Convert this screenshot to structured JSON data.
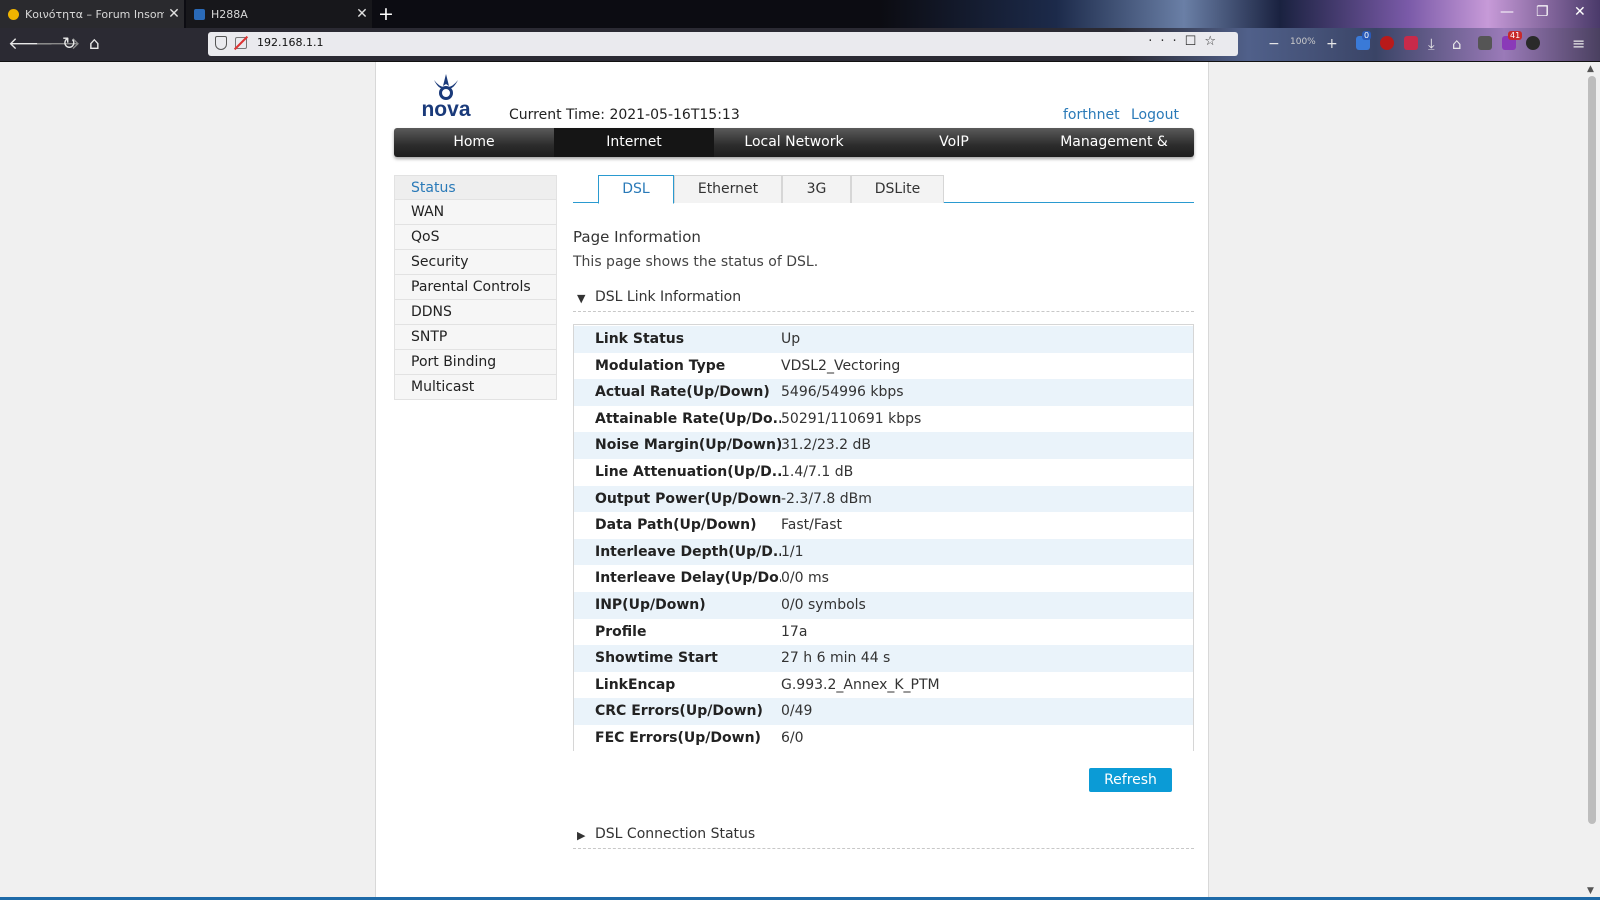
{
  "browser": {
    "tabs": [
      {
        "title": "Κοινότητα – Forum Insomnia.g",
        "active": false
      },
      {
        "title": "H288A",
        "active": true
      }
    ],
    "url": "192.168.1.1",
    "zoom": "100%",
    "ext_badges": [
      "0",
      "41"
    ]
  },
  "header": {
    "logo_text": "nova",
    "current_time": "Current Time: 2021-05-16T15:13",
    "user": "forthnet",
    "logout": "Logout"
  },
  "main_menu": [
    {
      "label": "Home",
      "active": false
    },
    {
      "label": "Internet",
      "active": true
    },
    {
      "label": "Local Network",
      "active": false
    },
    {
      "label": "VoIP",
      "active": false
    },
    {
      "label": "Management &",
      "active": false
    }
  ],
  "side_menu": [
    {
      "label": "Status",
      "active": true
    },
    {
      "label": "WAN",
      "active": false
    },
    {
      "label": "QoS",
      "active": false
    },
    {
      "label": "Security",
      "active": false
    },
    {
      "label": "Parental Controls",
      "active": false
    },
    {
      "label": "DDNS",
      "active": false
    },
    {
      "label": "SNTP",
      "active": false
    },
    {
      "label": "Port Binding",
      "active": false
    },
    {
      "label": "Multicast",
      "active": false
    }
  ],
  "sub_tabs": [
    {
      "label": "DSL",
      "active": true
    },
    {
      "label": "Ethernet",
      "active": false
    },
    {
      "label": "3G",
      "active": false
    },
    {
      "label": "DSLite",
      "active": false
    }
  ],
  "page_info": {
    "title": "Page Information",
    "description": "This page shows the status of DSL."
  },
  "dsl_link_info": {
    "title": "DSL Link Information",
    "rows": [
      {
        "key": "Link Status",
        "value": "Up"
      },
      {
        "key": "Modulation Type",
        "value": "VDSL2_Vectoring"
      },
      {
        "key": "Actual Rate(Up/Down)",
        "value": "5496/54996 kbps"
      },
      {
        "key": "Attainable Rate(Up/Do...",
        "value": "50291/110691 kbps"
      },
      {
        "key": "Noise Margin(Up/Down)",
        "value": "31.2/23.2 dB"
      },
      {
        "key": "Line Attenuation(Up/D...",
        "value": "1.4/7.1 dB"
      },
      {
        "key": "Output Power(Up/Down)",
        "value": "-2.3/7.8 dBm"
      },
      {
        "key": "Data Path(Up/Down)",
        "value": "Fast/Fast"
      },
      {
        "key": "Interleave Depth(Up/D...",
        "value": "1/1"
      },
      {
        "key": "Interleave Delay(Up/Do...",
        "value": "0/0 ms"
      },
      {
        "key": "INP(Up/Down)",
        "value": "0/0 symbols"
      },
      {
        "key": "Profile",
        "value": "17a"
      },
      {
        "key": "Showtime Start",
        "value": "27 h 6 min 44 s"
      },
      {
        "key": "LinkEncap",
        "value": "G.993.2_Annex_K_PTM"
      },
      {
        "key": "CRC Errors(Up/Down)",
        "value": "0/49"
      },
      {
        "key": "FEC Errors(Up/Down)",
        "value": "6/0"
      }
    ]
  },
  "refresh_label": "Refresh",
  "dsl_connection_status": {
    "title": "DSL Connection Status"
  }
}
